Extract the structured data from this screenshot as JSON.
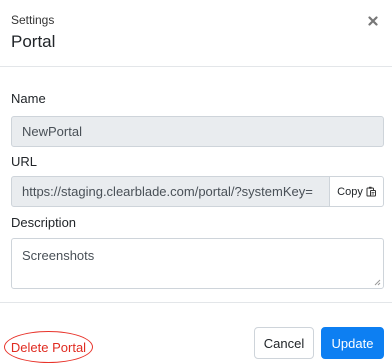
{
  "header": {
    "subtitle": "Settings",
    "title": "Portal",
    "close_icon": "close-icon"
  },
  "form": {
    "name": {
      "label": "Name",
      "value": "NewPortal"
    },
    "url": {
      "label": "URL",
      "value": "https://staging.clearblade.com/portal/?systemKey=",
      "copy_label": "Copy",
      "copy_icon": "clipboard-icon"
    },
    "description": {
      "label": "Description",
      "value": "Screenshots"
    }
  },
  "footer": {
    "delete_label": "Delete Portal",
    "cancel_label": "Cancel",
    "update_label": "Update"
  },
  "colors": {
    "primary": "#0d7ff2",
    "danger": "#e02b20",
    "readonly_bg": "#e9ecef"
  }
}
